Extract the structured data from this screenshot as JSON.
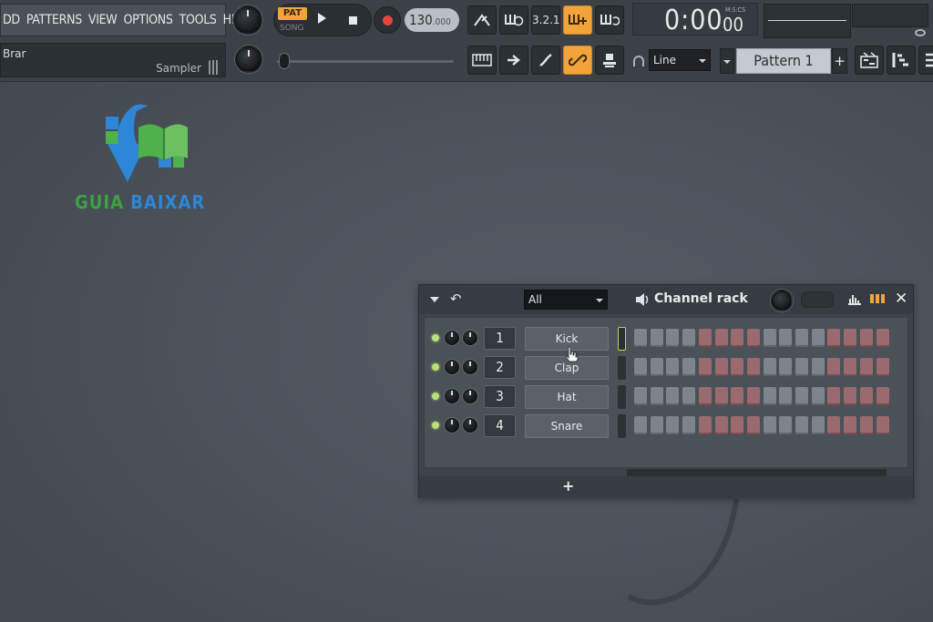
{
  "menu": [
    "DD",
    "PATTERNS",
    "VIEW",
    "OPTIONS",
    "TOOLS",
    "HELP"
  ],
  "hint_bar": {
    "title": "Brar",
    "subtitle": "Sampler"
  },
  "transport": {
    "pat_label": "PAT",
    "song_label": "SONG",
    "tempo": "130",
    "tempo_fraction": ".000"
  },
  "time_display": {
    "main": "0:00",
    "centiseconds": "00",
    "unit": "M:S:CS"
  },
  "snap": {
    "value": "Line"
  },
  "pattern": {
    "name": "Pattern 1",
    "add": "+"
  },
  "logo": {
    "word1": "GUIA",
    "word2": "BAIXAR"
  },
  "channel_rack": {
    "filter": "All",
    "title": "Channel rack",
    "add_label": "+",
    "channels": [
      {
        "number": "1",
        "name": "Kick",
        "selected": true
      },
      {
        "number": "2",
        "name": "Clap",
        "selected": false
      },
      {
        "number": "3",
        "name": "Hat",
        "selected": false
      },
      {
        "number": "4",
        "name": "Snare",
        "selected": false
      }
    ],
    "steps_per_channel": 16,
    "step_group_colors": {
      "gray": "#7c858c",
      "red": "#9b6a6e"
    }
  },
  "colors": {
    "accent": "#f2a43a",
    "record": "#e5443f",
    "led": "#b9e07a"
  }
}
